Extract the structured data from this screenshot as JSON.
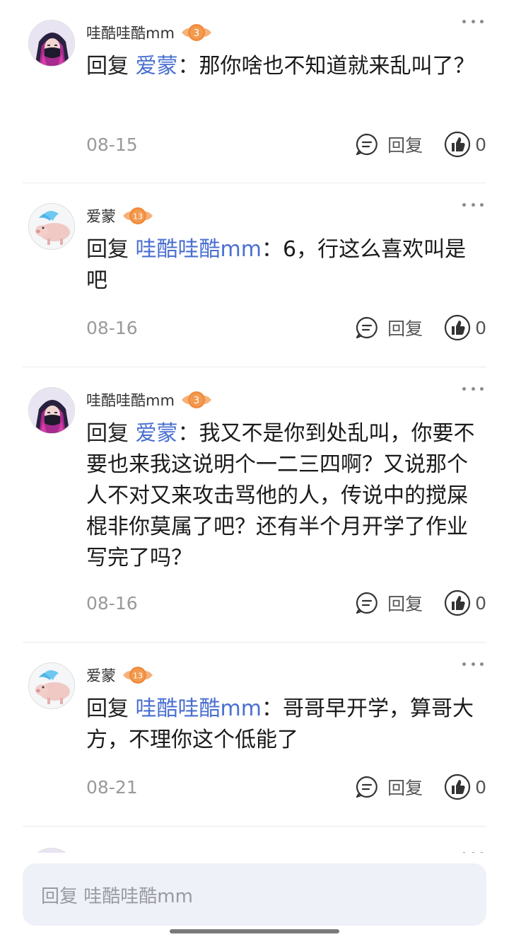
{
  "comments": [
    {
      "username": "哇酷哇酷mm",
      "level": "3",
      "avatar": "hooded-girl",
      "prefix": "回复 ",
      "mention": "爱蒙",
      "colon": "：",
      "text": "那你啥也不知道就来乱叫了？",
      "date": "08-15",
      "reply_label": "回复",
      "likes": "0"
    },
    {
      "username": "爱蒙",
      "level": "13",
      "avatar": "blue-pig",
      "prefix": "回复 ",
      "mention": "哇酷哇酷mm",
      "colon": "：",
      "text": "6，行这么喜欢叫是吧",
      "date": "08-16",
      "reply_label": "回复",
      "likes": "0"
    },
    {
      "username": "哇酷哇酷mm",
      "level": "3",
      "avatar": "hooded-girl",
      "prefix": "回复 ",
      "mention": "爱蒙",
      "colon": "：",
      "text": "我又不是你到处乱叫，你要不要也来我这说明个一二三四啊？又说那个人不对又来攻击骂他的人，传说中的搅屎棍非你莫属了吧？还有半个月开学了作业写完了吗？",
      "date": "08-16",
      "reply_label": "回复",
      "likes": "0"
    },
    {
      "username": "爱蒙",
      "level": "13",
      "avatar": "blue-pig",
      "prefix": "回复 ",
      "mention": "哇酷哇酷mm",
      "colon": "：",
      "text": "哥哥早开学，算哥大方，不理你这个低能了",
      "date": "08-21",
      "reply_label": "回复",
      "likes": "0"
    }
  ],
  "input": {
    "placeholder": "回复 哇酷哇酷mm"
  },
  "colors": {
    "mention": "#4a6fd1",
    "badge_orange": "#f08a3c",
    "input_bg": "#eef1f8"
  }
}
